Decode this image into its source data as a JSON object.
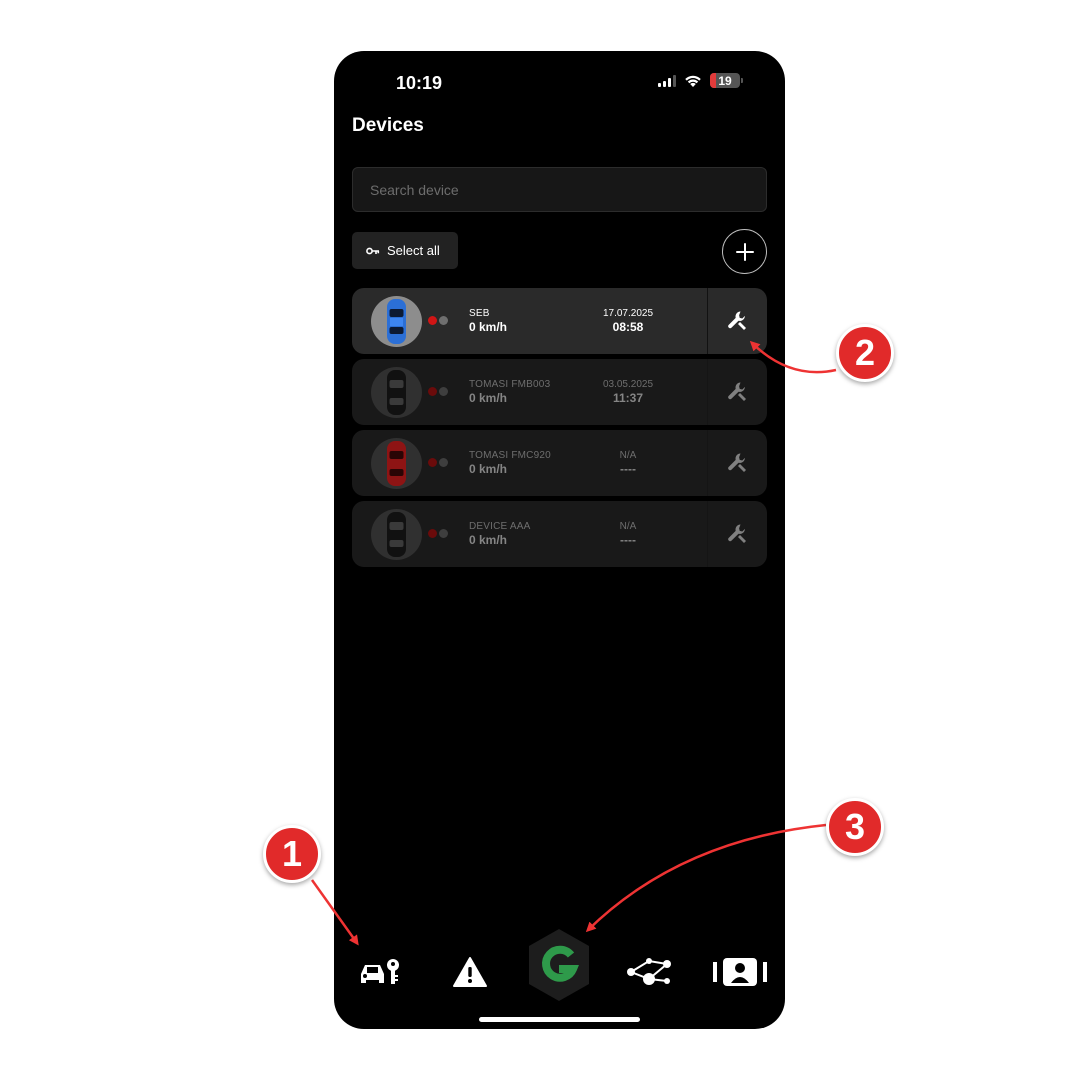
{
  "status_bar": {
    "time": "10:19",
    "battery_level": "19"
  },
  "header": {
    "title": "Devices"
  },
  "search": {
    "placeholder": "Search device",
    "value": ""
  },
  "toolbar": {
    "select_all_label": "Select all"
  },
  "devices": [
    {
      "name": "SEB",
      "speed": "0 km/h",
      "date": "17.07.2025",
      "time": "08:58",
      "car_color": "#2b6fd6",
      "active": true
    },
    {
      "name": "TOMASI FMB003",
      "speed": "0 km/h",
      "date": "03.05.2025",
      "time": "11:37",
      "car_color": "#1c1c1c",
      "active": false
    },
    {
      "name": "TOMASI FMC920",
      "speed": "0 km/h",
      "date": "N/A",
      "time": "----",
      "car_color": "#a11818",
      "active": false
    },
    {
      "name": "DEVICE AAA",
      "speed": "0 km/h",
      "date": "N/A",
      "time": "----",
      "car_color": "#1c1c1c",
      "active": false
    }
  ],
  "bottom_nav": [
    {
      "icon": "car-key-icon"
    },
    {
      "icon": "warning-icon"
    },
    {
      "icon": "g-logo-icon",
      "color": "#2e9a4a"
    },
    {
      "icon": "route-nodes-icon"
    },
    {
      "icon": "driver-card-icon"
    }
  ],
  "callouts": [
    "1",
    "2",
    "3"
  ],
  "colors": {
    "background": "#000000",
    "row_active": "#2a2a2a",
    "row": "#191919",
    "callout": "#e12a2a",
    "brand_green": "#2e9a4a"
  }
}
